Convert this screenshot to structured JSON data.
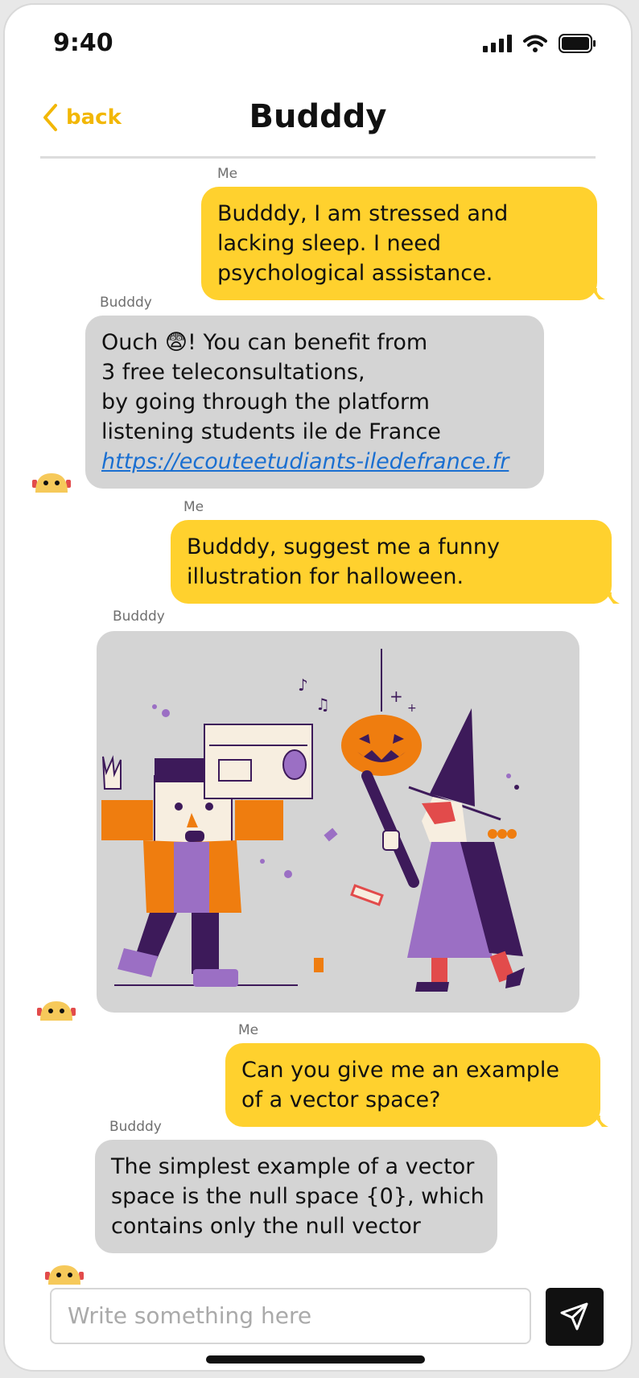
{
  "status": {
    "time": "9:40"
  },
  "nav": {
    "back_label": "back",
    "title": "Budddy"
  },
  "messages": [
    {
      "sender": "Me",
      "lines": [
        "Budddy, I am stressed and",
        "lacking sleep. I need",
        "psychological assistance."
      ]
    },
    {
      "sender": "Budddy",
      "lines": [
        "Ouch 😨! You can benefit from",
        "3 free teleconsultations,",
        "by going through the platform",
        "listening students ile de France"
      ],
      "link": " https://ecouteetudiants-iledefrance.fr"
    },
    {
      "sender": "Me",
      "lines": [
        "Budddy, suggest me a funny",
        "illustration for halloween."
      ]
    },
    {
      "sender": "Budddy"
    },
    {
      "sender": "Me",
      "lines": [
        "Can you give me an example",
        "of a vector space?"
      ]
    },
    {
      "sender": "Budddy",
      "lines": [
        "The simplest example of a vector",
        "space is the null space {0}, which",
        "contains only the null vector"
      ]
    }
  ],
  "input": {
    "placeholder": "Write something here"
  },
  "icons": {
    "back": "chevron-left-icon",
    "send": "paper-plane-icon",
    "signal": "signal-icon",
    "wifi": "wifi-icon",
    "battery": "battery-icon",
    "avatar": "robot-avatar-icon"
  },
  "colors": {
    "accent": "#ffd12e",
    "bot_bubble": "#d4d4d4",
    "link": "#1a6fd1",
    "back": "#f2b705"
  }
}
